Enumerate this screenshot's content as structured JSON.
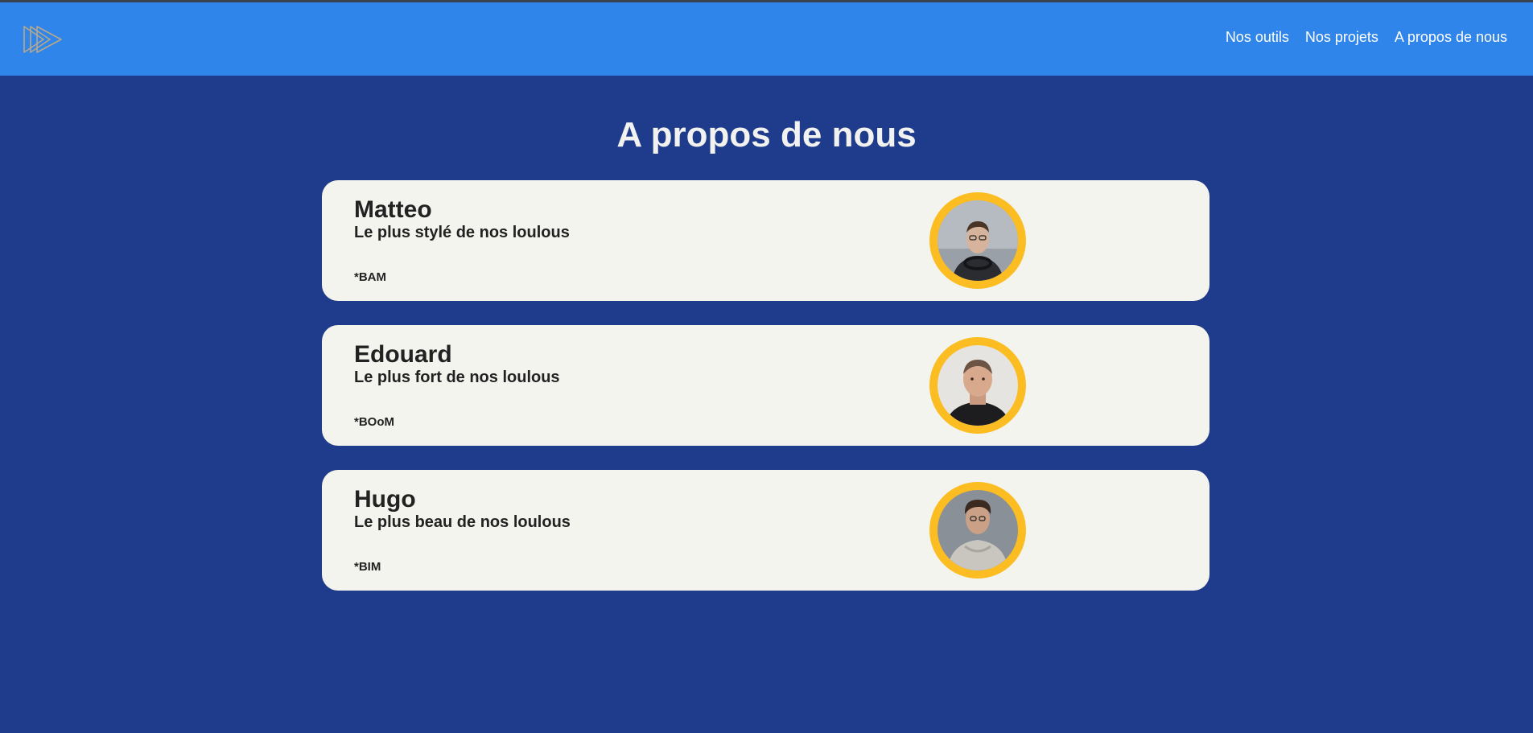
{
  "nav": {
    "logo_icon": "triple-play-triangle-logo",
    "links": [
      {
        "label": "Nos outils"
      },
      {
        "label": "Nos projets"
      },
      {
        "label": "A propos de nous"
      }
    ]
  },
  "page": {
    "title": "A propos de nous"
  },
  "colors": {
    "background": "#1f3b8b",
    "navbar": "#3085ea",
    "card": "#f4f4ef",
    "avatar_ring": "#fbbd22"
  },
  "members": [
    {
      "name": "Matteo",
      "subtitle": "Le plus stylé de nos loulous",
      "note": "*BAM"
    },
    {
      "name": "Edouard",
      "subtitle": "Le plus fort de nos loulous",
      "note": "*BOoM"
    },
    {
      "name": "Hugo",
      "subtitle": "Le plus beau de nos loulous",
      "note": "*BIM"
    }
  ]
}
